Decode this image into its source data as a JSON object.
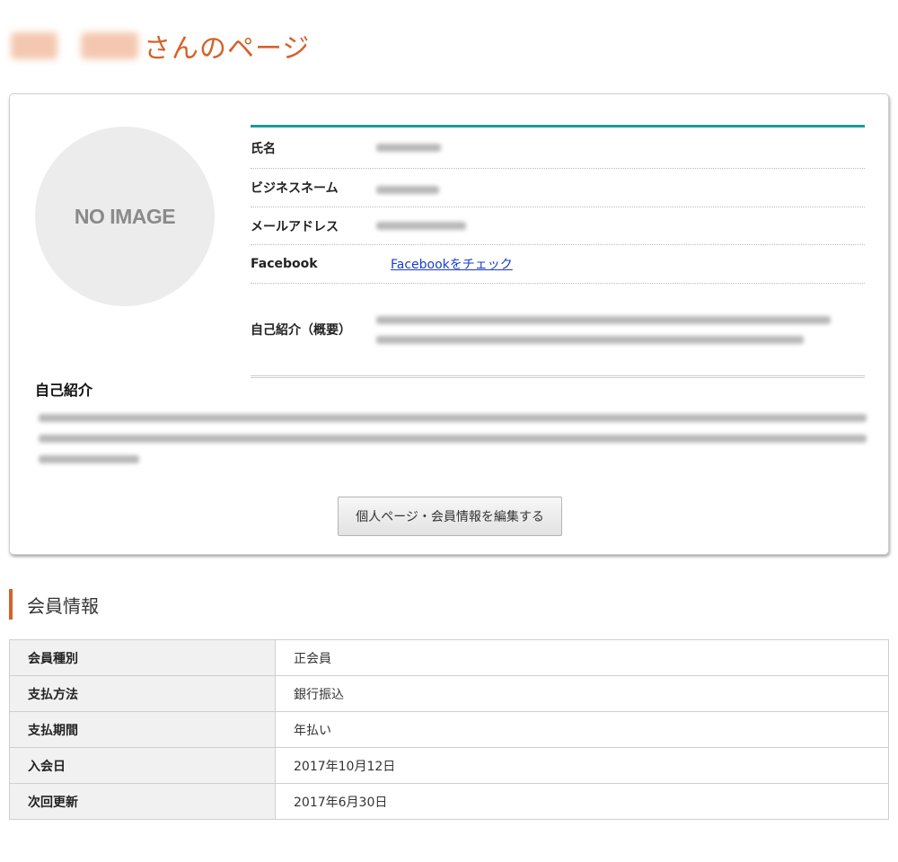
{
  "page": {
    "title_suffix": "さんのページ"
  },
  "profile": {
    "avatar_text": "NO IMAGE",
    "fields": {
      "name_label": "氏名",
      "business_name_label": "ビジネスネーム",
      "email_label": "メールアドレス",
      "facebook_label": "Facebook",
      "facebook_link": "Facebookをチェック",
      "intro_summary_label": "自己紹介（概要）"
    },
    "intro_heading": "自己紹介",
    "edit_button": "個人ページ・会員情報を編集する"
  },
  "membership": {
    "heading": "会員情報",
    "rows": [
      {
        "label": "会員種別",
        "value": "正会員"
      },
      {
        "label": "支払方法",
        "value": "銀行振込"
      },
      {
        "label": "支払期間",
        "value": "年払い"
      },
      {
        "label": "入会日",
        "value": "2017年10月12日"
      },
      {
        "label": "次回更新",
        "value": "2017年6月30日"
      }
    ]
  },
  "colors": {
    "accent": "#d4622b",
    "table_top_rule": "#1a9a9a",
    "link": "#1a3ccc"
  }
}
